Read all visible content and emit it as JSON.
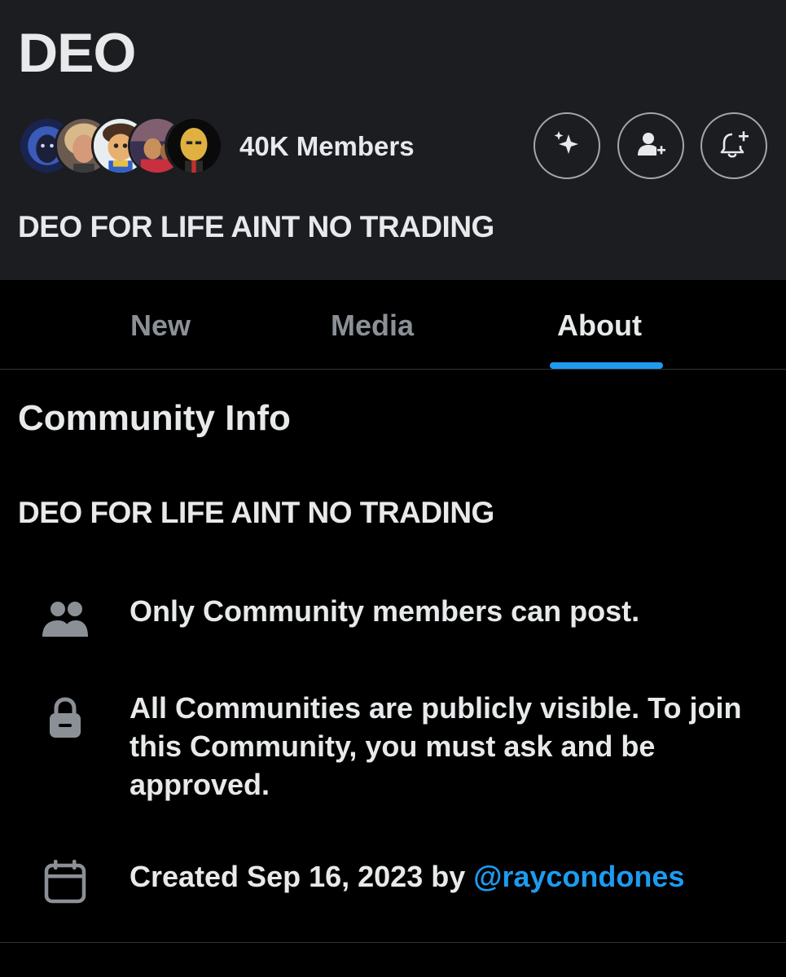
{
  "community": {
    "name": "DEO",
    "members_label": "40K Members",
    "description": "DEO FOR LIFE AINT NO TRADING"
  },
  "avatars": [
    {
      "name": "member-avatar-1",
      "color": "#2a3d7a"
    },
    {
      "name": "member-avatar-2",
      "color": "#b08060"
    },
    {
      "name": "member-avatar-3",
      "color": "#e6b040"
    },
    {
      "name": "member-avatar-4",
      "color": "#5a4a8a"
    },
    {
      "name": "member-avatar-5",
      "color": "#c9a040"
    }
  ],
  "actions": {
    "sparkle": "sparkle-icon",
    "invite": "add-person-icon",
    "notify": "bell-plus-icon"
  },
  "tabs": [
    {
      "label": "New",
      "active": false
    },
    {
      "label": "Media",
      "active": false
    },
    {
      "label": "About",
      "active": true
    }
  ],
  "about": {
    "section_title": "Community Info",
    "description": "DEO FOR LIFE AINT NO TRADING",
    "rules": [
      {
        "icon": "people-icon",
        "text": "Only Community members can post."
      },
      {
        "icon": "lock-icon",
        "text": "All Communities are publicly visible. To join this Community, you must ask and be approved."
      }
    ],
    "created": {
      "icon": "calendar-icon",
      "prefix": "Created Sep 16, 2023 by ",
      "creator": "@raycondones"
    }
  },
  "colors": {
    "header_bg": "#1c1d21",
    "page_bg": "#000000",
    "accent": "#1d9bf0",
    "muted": "#8b9096"
  }
}
